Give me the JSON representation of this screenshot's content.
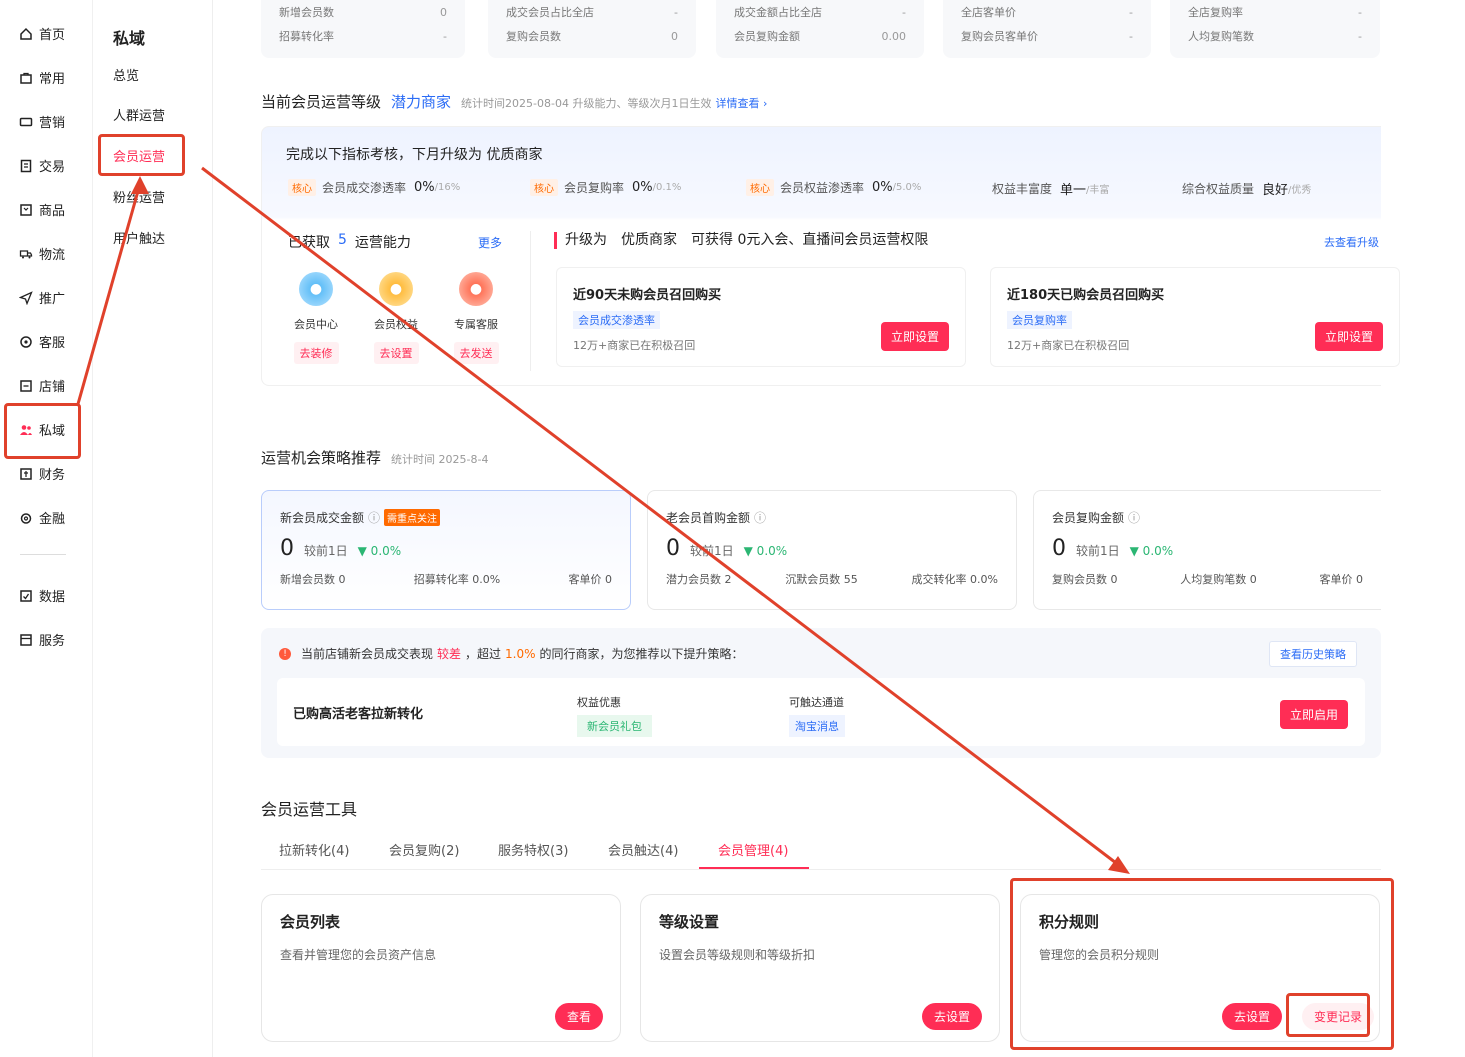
{
  "nav_primary": [
    {
      "label": "首页",
      "icon": "home-icon"
    },
    {
      "label": "常用",
      "icon": "bag-icon"
    },
    {
      "label": "营销",
      "icon": "ticket-icon"
    },
    {
      "label": "交易",
      "icon": "receipt-icon"
    },
    {
      "label": "商品",
      "icon": "box-icon"
    },
    {
      "label": "物流",
      "icon": "truck-icon"
    },
    {
      "label": "推广",
      "icon": "send-icon"
    },
    {
      "label": "客服",
      "icon": "headset-icon"
    },
    {
      "label": "店铺",
      "icon": "store-icon"
    },
    {
      "label": "私域",
      "icon": "users-icon"
    },
    {
      "label": "财务",
      "icon": "finance-icon"
    },
    {
      "label": "金融",
      "icon": "coin-icon"
    },
    {
      "label": "数据",
      "icon": "chart-icon"
    },
    {
      "label": "服务",
      "icon": "service-icon"
    }
  ],
  "nav_secondary": {
    "title": "私域",
    "items": [
      "总览",
      "人群运营",
      "会员运营",
      "粉丝运营",
      "用户触达"
    ]
  },
  "stats": [
    [
      {
        "label": "新增会员数",
        "value": "0"
      },
      {
        "label": "招募转化率",
        "value": "-"
      }
    ],
    [
      {
        "label": "成交会员占比全店",
        "value": "-"
      },
      {
        "label": "复购会员数",
        "value": "0"
      }
    ],
    [
      {
        "label": "成交金额占比全店",
        "value": "-"
      },
      {
        "label": "会员复购金额",
        "value": "0.00"
      }
    ],
    [
      {
        "label": "全店客单价",
        "value": "-"
      },
      {
        "label": "复购会员客单价",
        "value": "-"
      }
    ],
    [
      {
        "label": "全店复购率",
        "value": "-"
      },
      {
        "label": "人均复购笔数",
        "value": "-"
      }
    ]
  ],
  "level": {
    "title": "当前会员运营等级",
    "level_name": "潜力商家",
    "note": "统计时间2025-08-04 升级能力、等级次月1日生效",
    "detail_link": "详情查看",
    "upgrade_text": "完成以下指标考核，下月升级为 优质商家",
    "core_tag": "核心",
    "metrics": [
      {
        "label": "会员成交渗透率",
        "value": "0%",
        "target": "/16%"
      },
      {
        "label": "会员复购率",
        "value": "0%",
        "target": "/0.1%"
      },
      {
        "label": "会员权益渗透率",
        "value": "0%",
        "target": "/5.0%"
      },
      {
        "label": "权益丰富度",
        "value": "单一",
        "target": "/丰富"
      },
      {
        "label": "综合权益质量",
        "value": "良好",
        "target": "/优秀"
      }
    ],
    "abilities_prefix": "已获取",
    "abilities_count": "5",
    "abilities_suffix": "运营能力",
    "more": "更多",
    "abilities": [
      {
        "label": "会员中心",
        "action": "去装修"
      },
      {
        "label": "会员权益",
        "action": "去设置"
      },
      {
        "label": "专属客服",
        "action": "去发送"
      }
    ],
    "upgrade_banner": "升级为　优质商家　可获得 0元入会、直播间会员运营权限",
    "upgrade_link": "去查看升级",
    "recalls": [
      {
        "title": "近90天未购会员召回购买",
        "tag": "会员成交渗透率",
        "desc": "12万+商家已在积极召回",
        "button": "立即设置"
      },
      {
        "title": "近180天已购会员召回购买",
        "tag": "会员复购率",
        "desc": "12万+商家已在积极召回",
        "button": "立即设置"
      }
    ]
  },
  "opportunity": {
    "title": "运营机会策略推荐",
    "note": "统计时间 2025-8-4",
    "cards": [
      {
        "title": "新会员成交金额",
        "badge": "需重点关注",
        "value": "0",
        "compare": "较前1日",
        "change": "▼ 0.0%",
        "subs": [
          "新增会员数 0",
          "招募转化率 0.0%",
          "客单价 0"
        ]
      },
      {
        "title": "老会员首购金额",
        "badge": "",
        "value": "0",
        "compare": "较前1日",
        "change": "▼ 0.0%",
        "subs": [
          "潜力会员数 2",
          "沉默会员数 55",
          "成交转化率 0.0%"
        ]
      },
      {
        "title": "会员复购金额",
        "badge": "",
        "value": "0",
        "compare": "较前1日",
        "change": "▼ 0.0%",
        "subs": [
          "复购会员数 0",
          "人均复购笔数 0",
          "客单价 0"
        ]
      }
    ],
    "alert_pre": "当前店铺新会员成交表现",
    "alert_bad": "较差",
    "alert_mid": "，超过",
    "alert_pct": "1.0%",
    "alert_post": "的同行商家，为您推荐以下提升策略：",
    "history_btn": "查看历史策略",
    "strategy_name": "已购高活老客拉新转化",
    "benefit_label": "权益优惠",
    "benefit_value": "新会员礼包",
    "channel_label": "可触达通道",
    "channel_value": "淘宝消息",
    "enable_btn": "立即启用"
  },
  "tools": {
    "title": "会员运营工具",
    "tabs": [
      "拉新转化(4)",
      "会员复购(2)",
      "服务特权(3)",
      "会员触达(4)",
      "会员管理(4)"
    ],
    "active_tab": 4,
    "cards": [
      {
        "title": "会员列表",
        "desc": "查看并管理您的会员资产信息",
        "buttons": [
          "查看"
        ]
      },
      {
        "title": "等级设置",
        "desc": "设置会员等级规则和等级折扣",
        "buttons": [
          "去设置"
        ]
      },
      {
        "title": "积分规则",
        "desc": "管理您的会员积分规则",
        "buttons": [
          "去设置",
          "变更记录"
        ]
      }
    ]
  }
}
